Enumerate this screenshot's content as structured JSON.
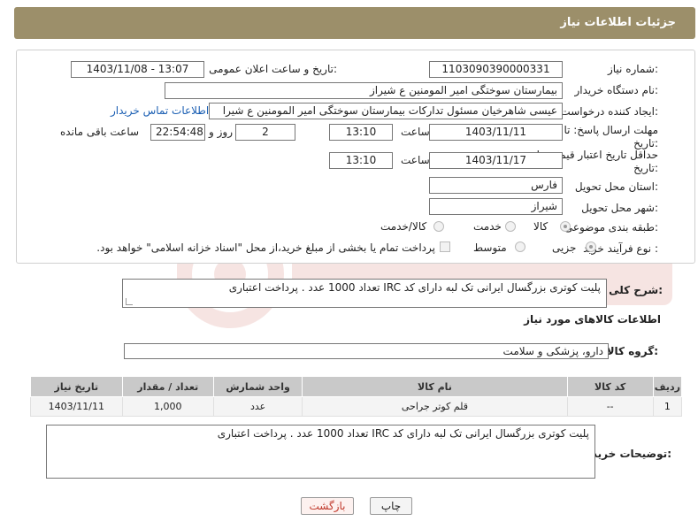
{
  "header": {
    "title": "جزئیات اطلاعات نیاز"
  },
  "form": {
    "need_number_label": "شماره نیاز:",
    "need_number_value": "1103090390000331",
    "announce_label": "تاریخ و ساعت اعلان عمومی:",
    "announce_value": "1403/11/08 - 13:07",
    "buyer_label": "نام دستگاه خریدار:",
    "buyer_value": "بیمارستان سوختگی امیر المومنین  ع  شیراز",
    "creator_label": "ایجاد کننده درخواست:",
    "creator_value": "عیسی  شاهرخیان مسئول تدارکات بیمارستان سوختگی امیر المومنین  ع  شیرا",
    "contact_link": "اطلاعات تماس خریدار",
    "deadline_label_1": "مهلت ارسال پاسخ: تا",
    "deadline_label_2": "تاریخ:",
    "deadline_date": "1403/11/11",
    "time_label": "ساعت",
    "deadline_time": "13:10",
    "days_value": "2",
    "days_label": "روز و",
    "remaining_value": "22:54:48",
    "remaining_label": "ساعت باقی مانده",
    "validity_label_1": "حداقل تاریخ اعتبار قیمت: تا",
    "validity_label_2": "تاریخ:",
    "validity_date": "1403/11/17",
    "validity_time": "13:10",
    "province_label": "استان محل تحویل:",
    "province_value": "فارس",
    "city_label": "شهر محل تحویل:",
    "city_value": "شیراز",
    "category_label": "طبقه بندی موضوعی:",
    "category_options": [
      "کالا",
      "خدمت",
      "کالا/خدمت"
    ],
    "category_selected": "کالا",
    "process_label": "نوع فرآیند خرید :",
    "process_options": [
      "جزیی",
      "متوسط"
    ],
    "process_selected": "جزیی",
    "payment_note": "پرداخت تمام یا بخشی از مبلغ خرید،از محل \"اسناد خزانه اسلامی\" خواهد بود."
  },
  "description": {
    "label": "شرح کلی نیاز:",
    "value": "پلیت کوتری بزرگسال ایرانی تک لبه دارای کد IRC تعداد 1000 عدد . پرداخت اعتباری"
  },
  "goods": {
    "section_title": "اطلاعات کالاهای مورد نیاز",
    "group_label": "گروه کالا:",
    "group_value": "دارو، پزشکی و سلامت",
    "columns": [
      "ردیف",
      "کد کالا",
      "نام کالا",
      "واحد شمارش",
      "تعداد / مقدار",
      "تاریخ نیاز"
    ],
    "rows": [
      [
        "1",
        "--",
        "قلم کوتر جراحی",
        "عدد",
        "1,000",
        "1403/11/11"
      ]
    ]
  },
  "buyer_notes": {
    "label": "توضیحات خریدار:",
    "value": "پلیت کوتری بزرگسال ایرانی تک لبه دارای کد  IRC تعداد 1000 عدد . پرداخت اعتباری"
  },
  "buttons": {
    "print": "چاپ",
    "back": "بازگشت"
  },
  "colors": {
    "header_bg": "#9c8f6a",
    "link": "#1b5fb3",
    "back_button_text": "#c0392b"
  }
}
